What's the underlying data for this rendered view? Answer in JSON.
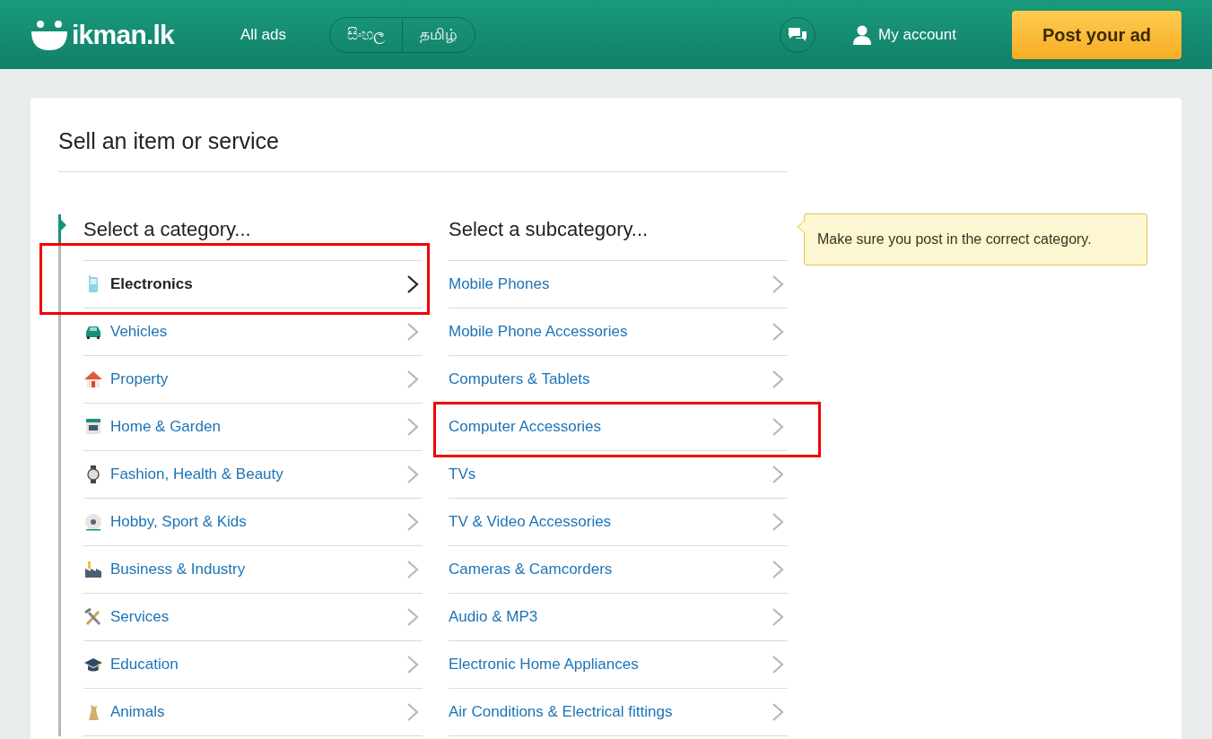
{
  "header": {
    "logo": "ikman.lk",
    "nav_link": "All ads",
    "languages": [
      {
        "label": "සිංහල"
      },
      {
        "label": "தமிழ்"
      }
    ],
    "account": "My account",
    "post_button": "Post your ad"
  },
  "page": {
    "title": "Sell an item or service"
  },
  "categories": {
    "heading": "Select a category...",
    "items": [
      {
        "label": "Electronics",
        "selected": true,
        "highlighted": true
      },
      {
        "label": "Vehicles",
        "selected": false,
        "highlighted": false
      },
      {
        "label": "Property",
        "selected": false,
        "highlighted": false
      },
      {
        "label": "Home & Garden",
        "selected": false,
        "highlighted": false
      },
      {
        "label": "Fashion, Health & Beauty",
        "selected": false,
        "highlighted": false
      },
      {
        "label": "Hobby, Sport & Kids",
        "selected": false,
        "highlighted": false
      },
      {
        "label": "Business & Industry",
        "selected": false,
        "highlighted": false
      },
      {
        "label": "Services",
        "selected": false,
        "highlighted": false
      },
      {
        "label": "Education",
        "selected": false,
        "highlighted": false
      },
      {
        "label": "Animals",
        "selected": false,
        "highlighted": false
      }
    ]
  },
  "subcategories": {
    "heading": "Select a subcategory...",
    "items": [
      {
        "label": "Mobile Phones",
        "highlighted": false
      },
      {
        "label": "Mobile Phone Accessories",
        "highlighted": false
      },
      {
        "label": "Computers & Tablets",
        "highlighted": false
      },
      {
        "label": "Computer Accessories",
        "highlighted": true
      },
      {
        "label": "TVs",
        "highlighted": false
      },
      {
        "label": "TV & Video Accessories",
        "highlighted": false
      },
      {
        "label": "Cameras & Camcorders",
        "highlighted": false
      },
      {
        "label": "Audio & MP3",
        "highlighted": false
      },
      {
        "label": "Electronic Home Appliances",
        "highlighted": false
      },
      {
        "label": "Air Conditions & Electrical fittings",
        "highlighted": false
      }
    ]
  },
  "tip": {
    "text": "Make sure you post in the correct category."
  }
}
